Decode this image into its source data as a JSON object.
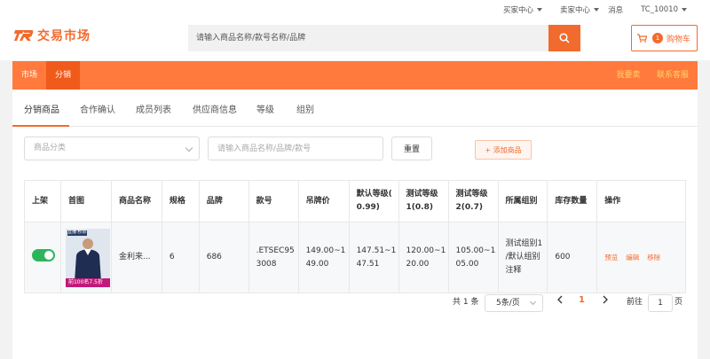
{
  "topbar": {
    "buyer_center": "买家中心",
    "seller_center": "卖家中心",
    "messages": "消息",
    "username": "TC_10010"
  },
  "header": {
    "logo_text": "交易市场",
    "search_placeholder": "请输入商品名称/款号名称/品牌",
    "cart_count": "1",
    "cart_label": "购物车"
  },
  "nav": {
    "items": [
      {
        "label": "市场"
      },
      {
        "label": "分销"
      }
    ],
    "right_items": [
      {
        "label": "我要卖"
      },
      {
        "label": "联系客服"
      }
    ]
  },
  "tabs": [
    {
      "label": "分销商品"
    },
    {
      "label": "合作确认"
    },
    {
      "label": "成员列表"
    },
    {
      "label": "供应商信息"
    },
    {
      "label": "等级"
    },
    {
      "label": "组别"
    }
  ],
  "filters": {
    "category_placeholder": "商品分类",
    "search_placeholder": "请输入商品名称/品牌/款号",
    "reset_label": "重置",
    "add_label": "+ 添加商品"
  },
  "table": {
    "headers": {
      "listed": "上架",
      "image": "首图",
      "name": "商品名称",
      "spec": "规格",
      "brand": "品牌",
      "style_no_1": "款号",
      "price": "吊牌价",
      "default_level_1": "默认等级(",
      "default_level_2": "0.99)",
      "test_level1_1": "测试等级",
      "test_level1_2": "1(0.8)",
      "test_level2_1": "测试等级",
      "test_level2_2": "2(0.7)",
      "group": "所属组别",
      "stock": "库存数量",
      "actions": "操作"
    },
    "rows": [
      {
        "listed": true,
        "thumb_badge": "直播·秒杀",
        "thumb_banner": "前100名7.5折",
        "name": "金利来...",
        "spec": "6",
        "brand": "686",
        "style_no_1": ".ETSEC95",
        "style_no_2": "3008",
        "price_1": "149.00~1",
        "price_2": "49.00",
        "default_level_1": "147.51~1",
        "default_level_2": "47.51",
        "test_level1_1": "120.00~1",
        "test_level1_2": "20.00",
        "test_level2_1": "105.00~1",
        "test_level2_2": "05.00",
        "group_1": "测试组别1",
        "group_2": "/默认组别",
        "group_3": "注释",
        "stock": "600",
        "action_preview": "预览",
        "action_edit": "编辑",
        "action_remove": "移除"
      }
    ]
  },
  "pagination": {
    "total": "共 1 条",
    "page_size": "5条/页",
    "current": "1",
    "goto_label": "前往",
    "goto_value": "1",
    "page_suffix": "页"
  },
  "colors": {
    "accent": "#f26b2e",
    "nav_bg": "#ff7a3c",
    "nav_active": "#f05a1a",
    "toggle_on": "#2db55d"
  }
}
